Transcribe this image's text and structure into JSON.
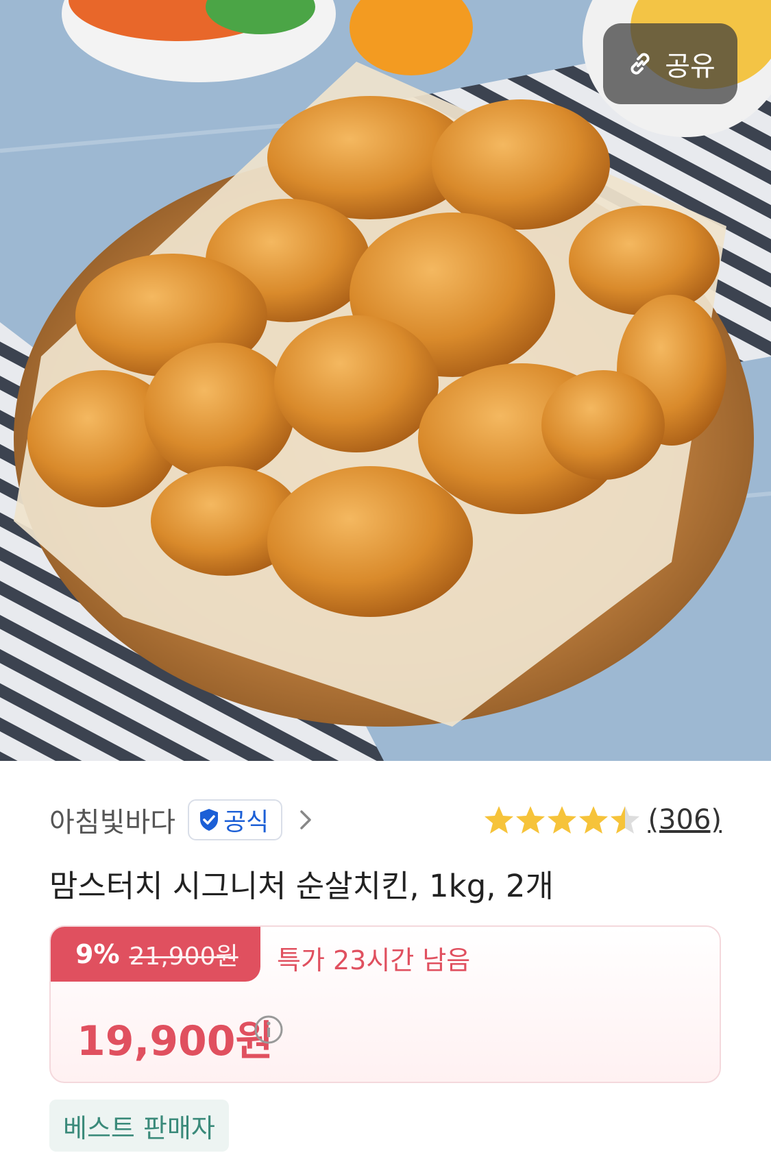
{
  "share": {
    "label": "공유",
    "icon": "link-icon"
  },
  "seller": {
    "name": "아침빛바다",
    "badge": "공식"
  },
  "rating": {
    "stars": 4.5,
    "max": 5,
    "count_label": "(306)"
  },
  "product": {
    "title": "맘스터치 시그니처 순살치킨, 1kg, 2개"
  },
  "price": {
    "discount_rate": "9%",
    "original_price": "21,900원",
    "deal_text": "특가 23시간 남음",
    "sale_price": "19,900원"
  },
  "badges": {
    "best_seller": "베스트 판매자"
  },
  "colors": {
    "accent": "#e0505f",
    "star": "#f6c33a",
    "official": "#1c5fd6",
    "best": "#3a8a7a"
  }
}
